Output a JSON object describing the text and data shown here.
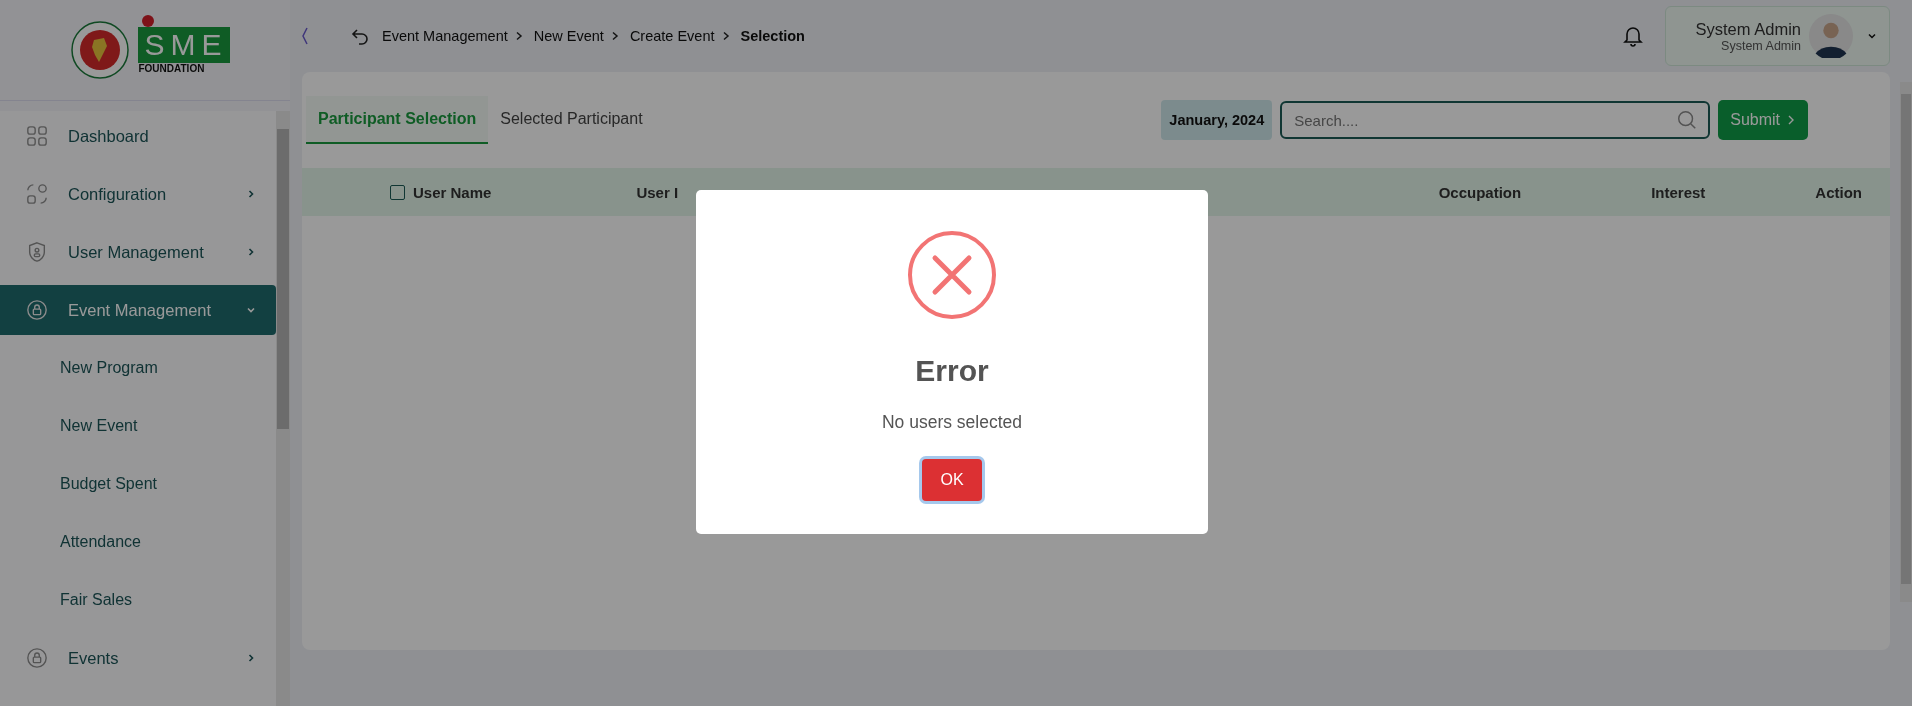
{
  "logo": {
    "mark": "SME",
    "caption": "FOUNDATION"
  },
  "sidebar": {
    "items": [
      {
        "label": "Dashboard",
        "kind": "link",
        "selected": false
      },
      {
        "label": "Configuration",
        "kind": "menu",
        "selected": false,
        "expanded": false
      },
      {
        "label": "User Management",
        "kind": "menu",
        "selected": false,
        "expanded": false
      },
      {
        "label": "Event Management",
        "kind": "menu",
        "selected": true,
        "expanded": true,
        "children": [
          {
            "label": "New Program",
            "selected": false
          },
          {
            "label": "New Event",
            "selected": false
          },
          {
            "label": "Budget Spent",
            "selected": false
          },
          {
            "label": "Attendance",
            "selected": false
          },
          {
            "label": "Fair Sales",
            "selected": false
          }
        ]
      },
      {
        "label": "Events",
        "kind": "menu",
        "selected": false,
        "expanded": false
      }
    ]
  },
  "header": {
    "breadcrumb": [
      "Event Management",
      "New Event",
      "Create Event"
    ],
    "current": "Selection",
    "user": {
      "name": "System Admin",
      "role": "System Admin"
    }
  },
  "tabs": [
    {
      "label": "Participant Selection",
      "selected": true
    },
    {
      "label": "Selected Participant",
      "selected": false
    }
  ],
  "month": "January, 2024",
  "search": {
    "placeholder": "Search...."
  },
  "submit": "Submit",
  "table": {
    "select_all": {
      "checked": false
    },
    "columns_left": [
      "User Name",
      "User I"
    ],
    "columns_right": [
      "Occupation",
      "Interest",
      "Action"
    ]
  },
  "dialog": {
    "title": "Error",
    "message": "No users selected",
    "button": "OK"
  }
}
